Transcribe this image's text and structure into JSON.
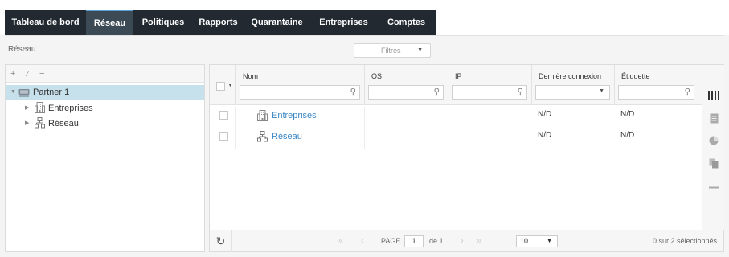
{
  "nav": {
    "tabs": [
      {
        "label": "Tableau de bord"
      },
      {
        "label": "Réseau"
      },
      {
        "label": "Politiques"
      },
      {
        "label": "Rapports"
      },
      {
        "label": "Quarantaine"
      },
      {
        "label": "Entreprises"
      },
      {
        "label": "Comptes"
      }
    ]
  },
  "breadcrumb": "Réseau",
  "filters_label": "Filtres",
  "tree": {
    "toolbar": {
      "add": "+",
      "edit": "⁄",
      "remove": "−"
    },
    "items": [
      {
        "label": "Partner 1",
        "icon": "computer-icon"
      },
      {
        "label": "Entreprises",
        "icon": "building-icon"
      },
      {
        "label": "Réseau",
        "icon": "network-icon"
      }
    ]
  },
  "grid": {
    "columns": [
      {
        "label": "Nom",
        "filter": "search"
      },
      {
        "label": "OS",
        "filter": "search"
      },
      {
        "label": "IP",
        "filter": "search"
      },
      {
        "label": "Dernière connexion",
        "filter": "dropdown"
      },
      {
        "label": "Étiquette",
        "filter": "search"
      }
    ],
    "rows": [
      {
        "name": "Entreprises",
        "icon": "building-icon",
        "os": "",
        "ip": "",
        "last": "N/D",
        "tag": "N/D"
      },
      {
        "name": "Réseau",
        "icon": "network-icon",
        "os": "",
        "ip": "",
        "last": "N/D",
        "tag": "N/D"
      }
    ]
  },
  "pager": {
    "page_label": "PAGE",
    "page_value": "1",
    "of_label": "de 1",
    "page_size": "10",
    "selection": "0 sur 2 sélectionnés"
  },
  "colors": {
    "nav_bg": "#222930",
    "nav_active": "#3c4a55",
    "selected_row": "#c7e1ec",
    "link": "#3b86c4"
  }
}
